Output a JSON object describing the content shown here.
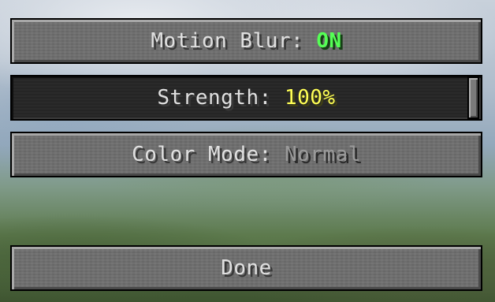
{
  "options": {
    "motion_blur": {
      "label": "Motion Blur: ",
      "value": "ON",
      "value_color": "#55ff55"
    },
    "strength": {
      "label": "Strength: ",
      "value": "100%",
      "value_color": "#ffff55",
      "level": 1.0
    },
    "color_mode": {
      "label": "Color Mode: ",
      "value": "Normal",
      "value_color": "#9a9a9a"
    }
  },
  "done_label": "Done"
}
